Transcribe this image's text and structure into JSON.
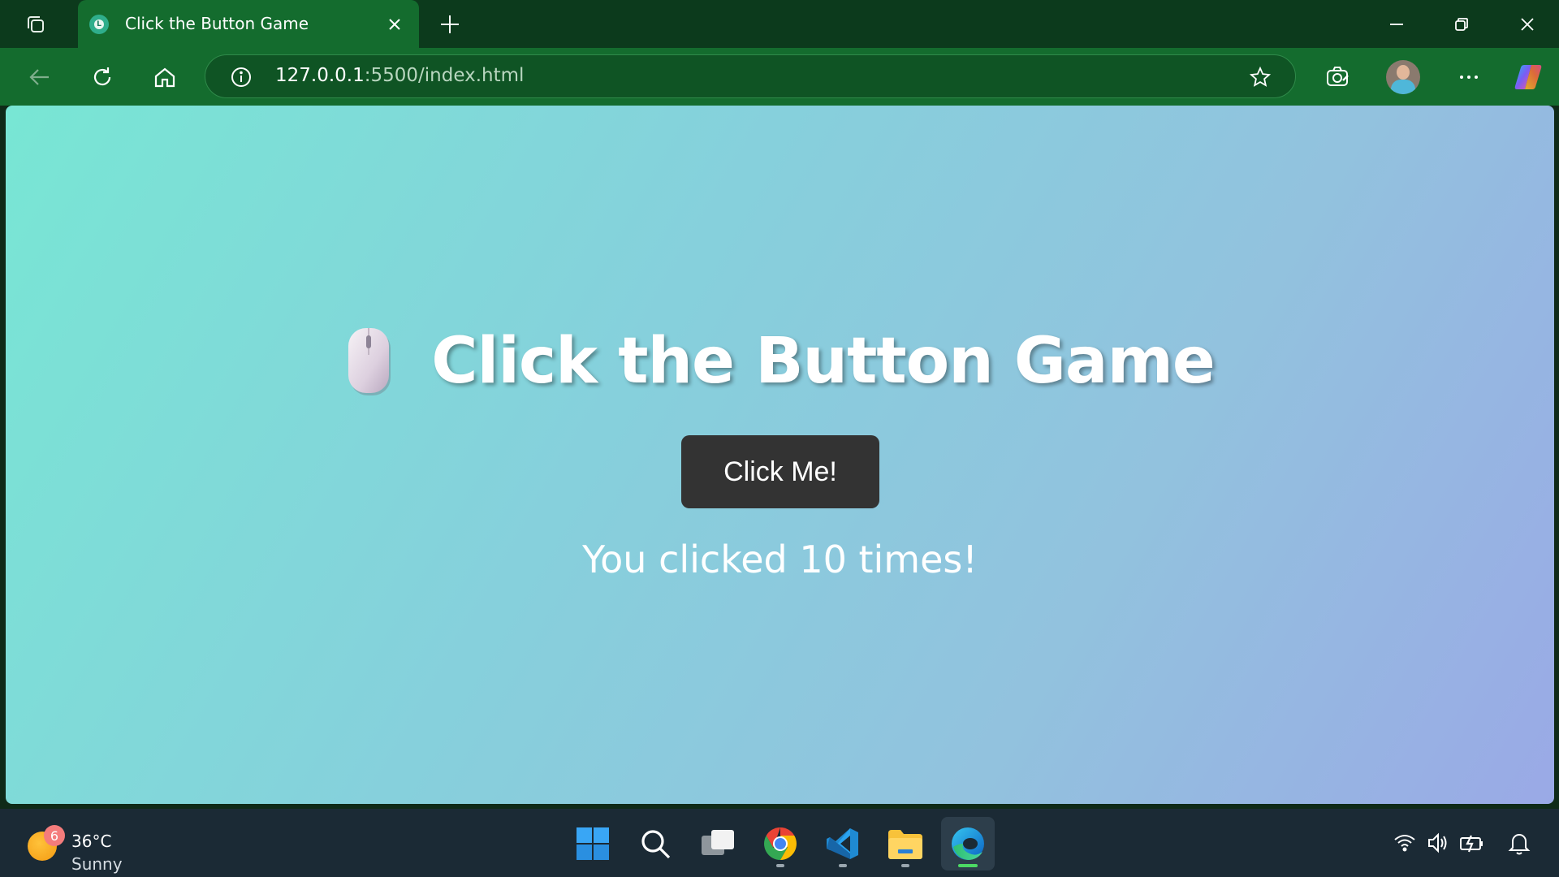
{
  "browser": {
    "tab": {
      "title": "Click the Button Game",
      "favicon_letter": "L"
    },
    "address": {
      "url_host": "127.0.0.1",
      "url_rest": ":5500/index.html"
    }
  },
  "page": {
    "heading": "Click the Button Game",
    "button_label": "Click Me!",
    "counter_text": "You clicked 10 times!"
  },
  "taskbar": {
    "weather": {
      "badge": "6",
      "temperature": "36°C",
      "condition": "Sunny"
    },
    "apps": [
      "start",
      "search",
      "task-view",
      "chrome",
      "vscode",
      "file-explorer",
      "edge"
    ],
    "active_app": "edge"
  },
  "colors": {
    "titlebar": "#0c3a1c",
    "toolbar": "#146c2e",
    "button": "#333333",
    "taskbar": "#1b2a35"
  }
}
